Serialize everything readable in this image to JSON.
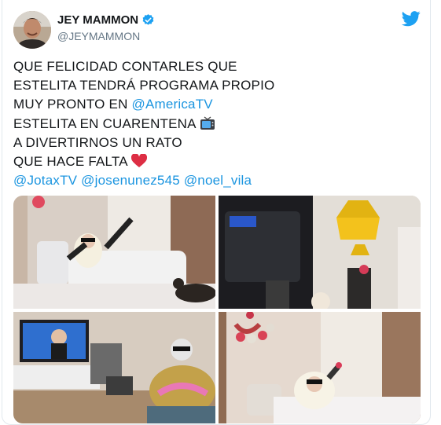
{
  "author": {
    "display_name": "JEY MAMMON",
    "handle": "@JEYMAMMON"
  },
  "tweet": {
    "line1": "QUE FELICIDAD CONTARLES QUE",
    "line2": "ESTELITA TENDRÁ PROGRAMA PROPIO",
    "line3_prefix": "MUY PRONTO EN ",
    "line3_mention": "@AmericaTV",
    "line4": "ESTELITA EN CUARENTENA",
    "line5": "A DIVERTIRNOS UN RATO",
    "line6": "QUE HACE FALTA",
    "mentions": [
      "@JotaxTV",
      "@josenunez545",
      "@noel_vila"
    ]
  },
  "icons": {
    "verified": "verified-badge-icon",
    "brand": "twitter-bird-icon",
    "tv_emoji": "tv-emoji-icon",
    "heart_emoji": "red-heart-emoji-icon"
  },
  "colors": {
    "link": "#1b95e0",
    "text": "#14171a",
    "muted": "#657786",
    "twitter_blue": "#1da1f2",
    "heart": "#e0245e"
  }
}
